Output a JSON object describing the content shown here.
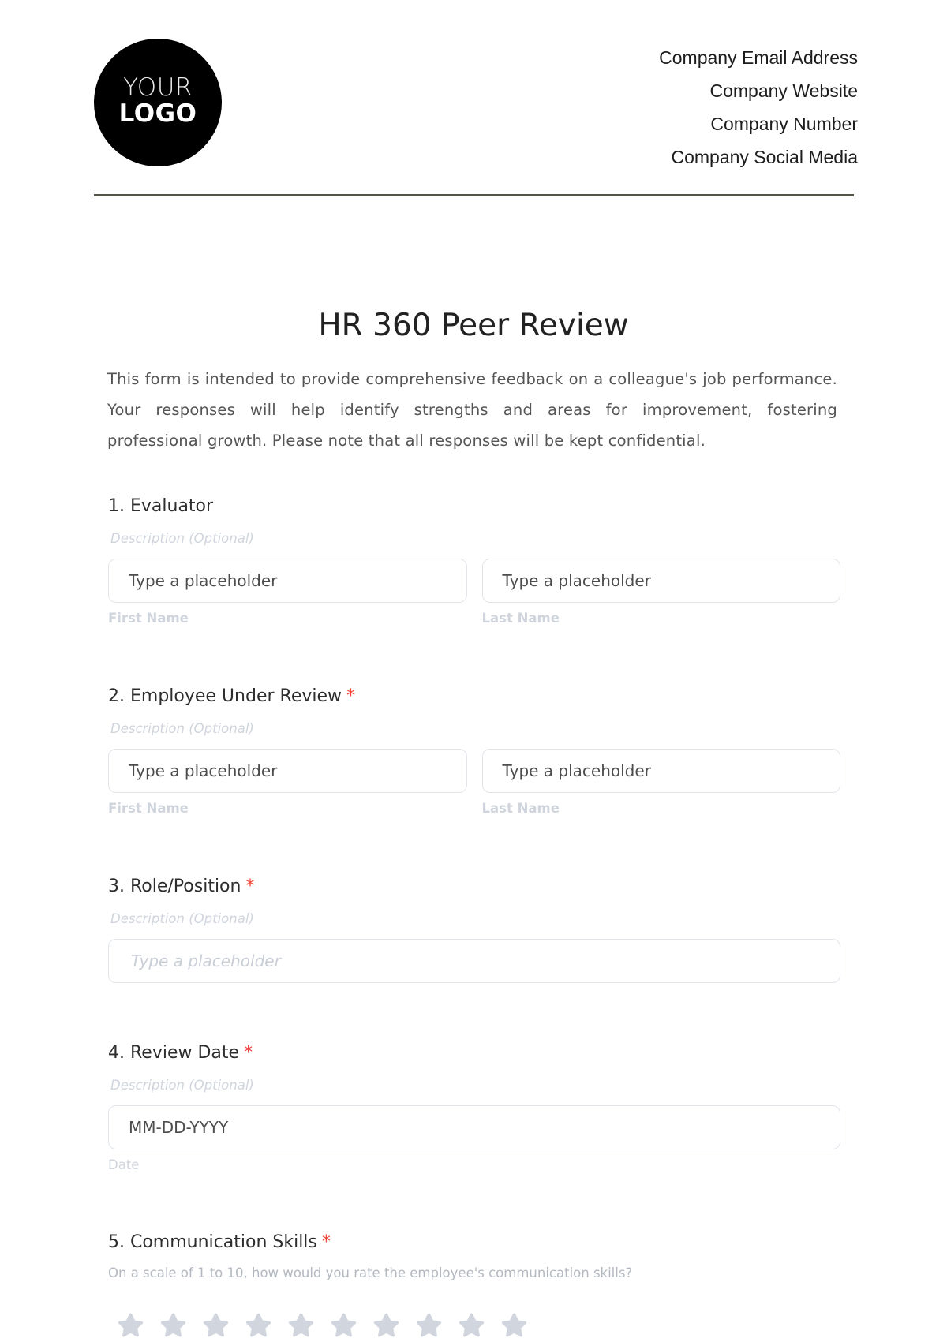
{
  "header": {
    "logo": {
      "line1": "YOUR",
      "line2": "LOGO"
    },
    "company": {
      "email": "Company Email Address",
      "website": "Company Website",
      "number": "Company Number",
      "social": "Company Social Media"
    }
  },
  "form": {
    "title": "HR 360 Peer Review",
    "intro": "This form is intended to provide comprehensive feedback on a colleague's job performance. Your responses will help identify strengths and areas for improvement, fostering professional growth. Please note that all responses will be kept confidential.",
    "required_marker": "*",
    "questions": [
      {
        "title": "1. Evaluator",
        "required": false,
        "description": "Description (Optional)",
        "fields": [
          {
            "placeholder": "Type a placeholder",
            "sublabel": "First Name"
          },
          {
            "placeholder": "Type a placeholder",
            "sublabel": "Last Name"
          }
        ]
      },
      {
        "title": "2. Employee Under Review",
        "required": true,
        "description": "Description (Optional)",
        "fields": [
          {
            "placeholder": "Type a placeholder",
            "sublabel": "First Name"
          },
          {
            "placeholder": "Type a placeholder",
            "sublabel": "Last Name"
          }
        ]
      },
      {
        "title": "3. Role/Position",
        "required": true,
        "description": "Description (Optional)",
        "fields": [
          {
            "placeholder": "Type a placeholder"
          }
        ]
      },
      {
        "title": "4. Review Date",
        "required": true,
        "description": "Description (Optional)",
        "fields": [
          {
            "placeholder": "MM-DD-YYYY",
            "sublabel": "Date"
          }
        ]
      },
      {
        "title": "5. Communication Skills",
        "required": true,
        "description": "On a scale of 1 to 10, how would you rate the employee's communication skills?",
        "rating": {
          "max": 10,
          "value": 0,
          "icon": "star-icon",
          "color": "#d1d6de"
        }
      }
    ]
  },
  "colors": {
    "divider": "#55564a",
    "required": "#f44336",
    "star_empty": "#d1d6de"
  }
}
